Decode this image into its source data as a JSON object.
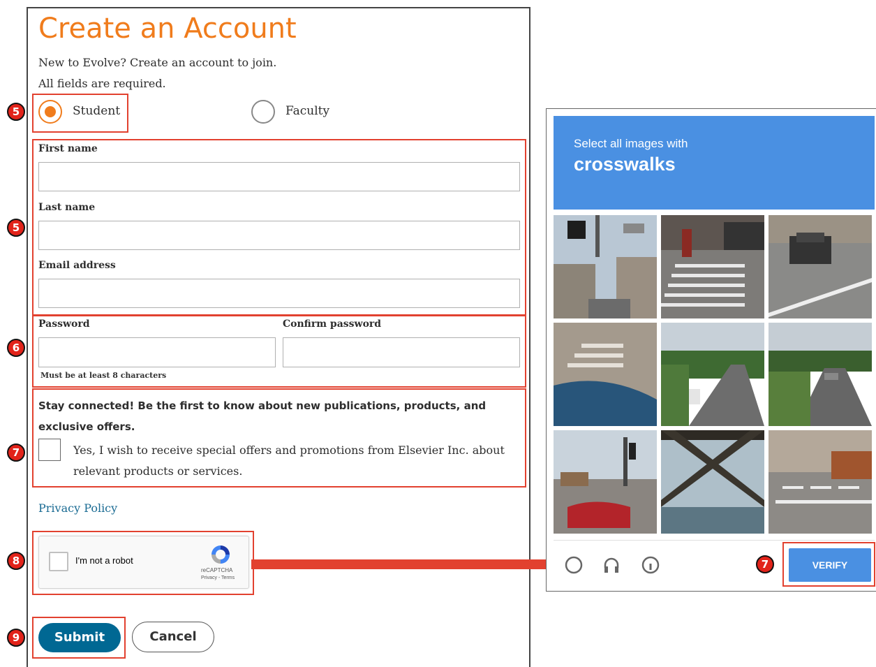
{
  "form": {
    "title": "Create an Account",
    "intro_line": "New to Evolve? Create an account to join.",
    "required_note": "All fields are required.",
    "role_options": [
      {
        "label": "Student",
        "selected": true
      },
      {
        "label": "Faculty",
        "selected": false
      }
    ],
    "fields": {
      "first_name_label": "First name",
      "last_name_label": "Last name",
      "email_label": "Email address",
      "password_label": "Password",
      "confirm_password_label": "Confirm password",
      "password_hint": "Must be at least 8 characters"
    },
    "offers": {
      "heading": "Stay connected! Be the first to know about new publications, products, and exclusive offers.",
      "checkbox_label": "Yes, I wish to receive special offers and promotions from Elsevier Inc. about relevant products or services.",
      "checked": false
    },
    "privacy_link": "Privacy Policy",
    "recaptcha": {
      "label": "I'm not a robot",
      "brand": "reCAPTCHA",
      "legal": "Privacy - Terms"
    },
    "submit_label": "Submit",
    "cancel_label": "Cancel"
  },
  "step_badges": {
    "role": "5",
    "names": "5",
    "password": "6",
    "offers": "7",
    "recaptcha": "8",
    "submit": "9",
    "verify": "7"
  },
  "challenge": {
    "instruction": "Select all images with",
    "keyword": "crosswalks",
    "tiles": [
      "street-intersection-tile",
      "crosswalk-tile",
      "parked-suv-tile",
      "crosswalk-car-hood-tile",
      "highway-car-tile",
      "rural-road-tile",
      "traffic-light-tile",
      "bridge-underside-tile",
      "sidewalk-crosswalk-tile"
    ],
    "verify_label": "VERIFY"
  },
  "colors": {
    "accent_orange": "#f07c1c",
    "annotation_red": "#e2412f",
    "submit_blue": "#006893",
    "captcha_blue": "#4a90e2",
    "link_blue": "#1a6b93"
  }
}
